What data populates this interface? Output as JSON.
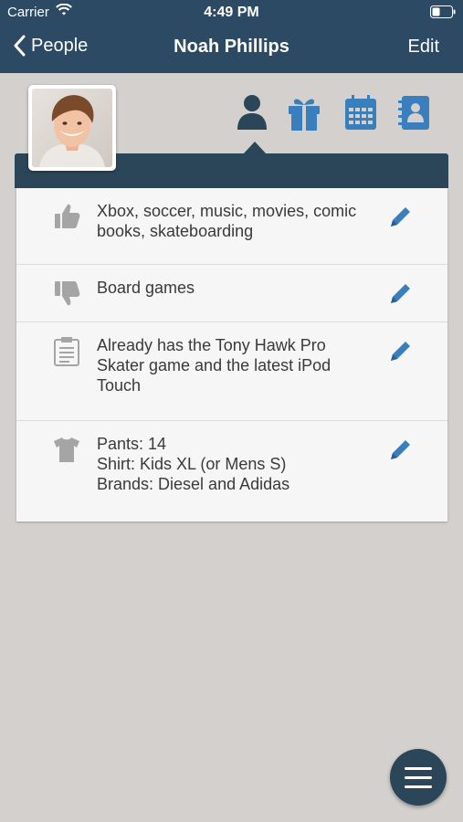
{
  "status": {
    "carrier": "Carrier",
    "time": "4:49 PM"
  },
  "nav": {
    "back_label": "People",
    "title": "Noah Phillips",
    "edit_label": "Edit"
  },
  "tabs": [
    {
      "icon": "person-icon",
      "selected": true
    },
    {
      "icon": "gift-icon",
      "selected": false
    },
    {
      "icon": "calendar-icon",
      "selected": false
    },
    {
      "icon": "address-book-icon",
      "selected": false
    }
  ],
  "rows": [
    {
      "icon": "thumbs-up-icon",
      "text": "Xbox, soccer, music, movies, comic\nbooks, skateboarding"
    },
    {
      "icon": "thumbs-down-icon",
      "text": "Board games"
    },
    {
      "icon": "clipboard-icon",
      "text": "Already has the Tony Hawk Pro\nSkater game and the latest iPod\nTouch"
    },
    {
      "icon": "tshirt-icon",
      "text": "Pants: 14\nShirt: Kids XL (or Mens S)\nBrands: Diesel and Adidas"
    }
  ],
  "colors": {
    "nav": "#2c4a63",
    "accent": "#3a7fbd",
    "icon_gray": "#a5a5a5",
    "background": "#d3d0cd"
  }
}
